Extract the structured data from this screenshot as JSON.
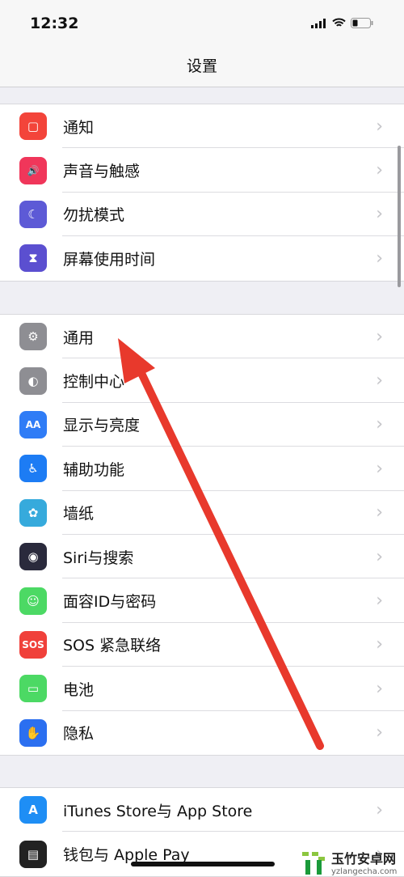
{
  "status": {
    "time": "12:32",
    "icons": [
      "signal-icon",
      "wifi-icon",
      "battery-icon"
    ]
  },
  "header": {
    "title": "设置"
  },
  "groups": [
    {
      "items": [
        {
          "label": "通知",
          "icon": "notifications-icon",
          "color": "#f3443a",
          "glyph": "▢"
        },
        {
          "label": "声音与触感",
          "icon": "sound-icon",
          "color": "#f0365a",
          "glyph": "🔊"
        },
        {
          "label": "勿扰模式",
          "icon": "moon-icon",
          "color": "#5d5ad6",
          "glyph": "☾"
        },
        {
          "label": "屏幕使用时间",
          "icon": "hourglass-icon",
          "color": "#5b4fd0",
          "glyph": "⧗"
        }
      ]
    },
    {
      "items": [
        {
          "label": "通用",
          "icon": "gear-icon",
          "color": "#8e8e93",
          "glyph": "⚙"
        },
        {
          "label": "控制中心",
          "icon": "toggle-icon",
          "color": "#8e8e93",
          "glyph": "◐"
        },
        {
          "label": "显示与亮度",
          "icon": "display-icon",
          "color": "#2f7cf6",
          "glyph": "AA"
        },
        {
          "label": "辅助功能",
          "icon": "accessibility-icon",
          "color": "#1d7cf4",
          "glyph": "♿"
        },
        {
          "label": "墙纸",
          "icon": "wallpaper-icon",
          "color": "#36aadc",
          "glyph": "✿"
        },
        {
          "label": "Siri与搜索",
          "icon": "siri-icon",
          "color": "#2a2a3c",
          "glyph": "◉"
        },
        {
          "label": "面容ID与密码",
          "icon": "face-id-icon",
          "color": "#4cd964",
          "glyph": "☺"
        },
        {
          "label": "SOS 紧急联络",
          "icon": "sos-icon",
          "color": "#f0403a",
          "glyph": "SOS"
        },
        {
          "label": "电池",
          "icon": "battery-icon",
          "color": "#4cd964",
          "glyph": "▭"
        },
        {
          "label": "隐私",
          "icon": "hand-icon",
          "color": "#2b6ff0",
          "glyph": "✋"
        }
      ]
    },
    {
      "items": [
        {
          "label": "iTunes Store与 App Store",
          "icon": "app-store-icon",
          "color": "#1e8ef5",
          "glyph": "A"
        },
        {
          "label": "钱包与 Apple Pay",
          "icon": "wallet-icon",
          "color": "#222",
          "glyph": "▤"
        }
      ]
    }
  ],
  "annotation": {
    "arrow_color": "#e8392c"
  },
  "watermark": {
    "name": "玉竹安卓网",
    "url": "yzlangecha.com"
  }
}
